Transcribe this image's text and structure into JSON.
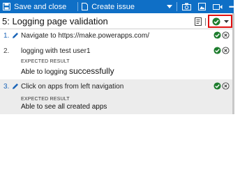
{
  "toolbar": {
    "save_label": "Save and close",
    "create_issue_label": "Create issue",
    "more_label": "•••"
  },
  "test": {
    "title": "5: Logging page validation"
  },
  "steps": [
    {
      "number": "1.",
      "text": "Navigate to https://make.powerapps.com/"
    },
    {
      "number": "2.",
      "text": "logging with test user1",
      "expected_label": "EXPECTED RESULT",
      "expected_a": "Able to logging ",
      "expected_b": "successfully"
    },
    {
      "number": "3.",
      "text": "Click on apps from left navigation",
      "expected_label": "EXPECTED RESULT",
      "expected": "Able to see all created apps"
    }
  ],
  "colors": {
    "toolbar_bg": "#0f6fc6",
    "pass": "#1e7d2e",
    "highlight": "#e01010",
    "active_row": "#ececec"
  }
}
